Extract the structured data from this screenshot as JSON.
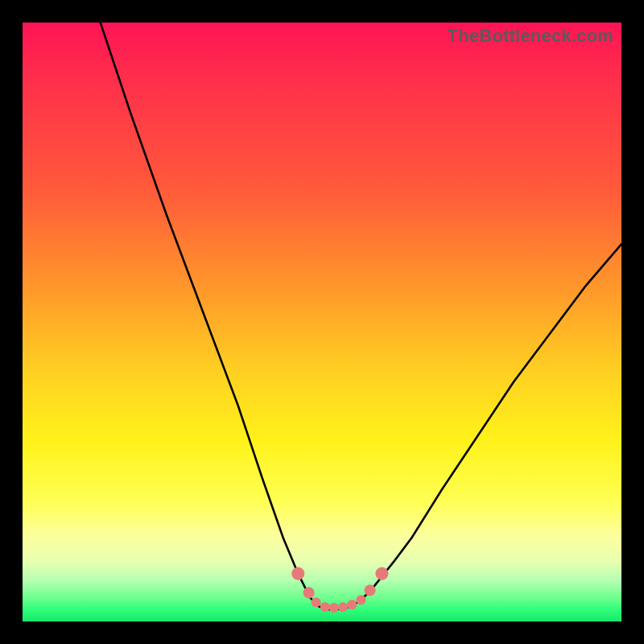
{
  "watermark": "TheBottleneck.com",
  "chart_data": {
    "type": "line",
    "title": "",
    "xlabel": "",
    "ylabel": "",
    "xlim": [
      0,
      100
    ],
    "ylim": [
      0,
      100
    ],
    "grid": false,
    "legend": false,
    "series": [
      {
        "name": "bottleneck-curve",
        "x": [
          13,
          18,
          24,
          30,
          36,
          40,
          43.5,
          46,
          48,
          49.5,
          51,
          52.5,
          54,
          56,
          58,
          60,
          62,
          65,
          70,
          76,
          82,
          88,
          94,
          100
        ],
        "y": [
          100,
          85,
          68,
          52,
          36,
          24,
          14,
          8,
          4,
          2.5,
          2,
          2,
          2.2,
          3.2,
          5,
          7.5,
          10,
          14,
          22,
          31,
          40,
          48,
          56,
          63
        ]
      }
    ],
    "markers": {
      "name": "valley-markers",
      "color": "#e77a78",
      "points": [
        {
          "x": 46.0,
          "y": 8.0,
          "r": 8
        },
        {
          "x": 47.8,
          "y": 4.8,
          "r": 7
        },
        {
          "x": 49.0,
          "y": 3.2,
          "r": 6
        },
        {
          "x": 50.5,
          "y": 2.4,
          "r": 6
        },
        {
          "x": 52.0,
          "y": 2.3,
          "r": 6
        },
        {
          "x": 53.5,
          "y": 2.4,
          "r": 6
        },
        {
          "x": 55.0,
          "y": 2.8,
          "r": 6
        },
        {
          "x": 56.5,
          "y": 3.6,
          "r": 6
        },
        {
          "x": 58.0,
          "y": 5.2,
          "r": 7
        },
        {
          "x": 60.0,
          "y": 8.0,
          "r": 8
        }
      ]
    },
    "gradient_stops": [
      {
        "pos": 0,
        "color": "#ff1355"
      },
      {
        "pos": 28,
        "color": "#ff5a3a"
      },
      {
        "pos": 58,
        "color": "#ffcf22"
      },
      {
        "pos": 80,
        "color": "#ffff55"
      },
      {
        "pos": 93,
        "color": "#b8ffb2"
      },
      {
        "pos": 100,
        "color": "#18e76a"
      }
    ]
  }
}
